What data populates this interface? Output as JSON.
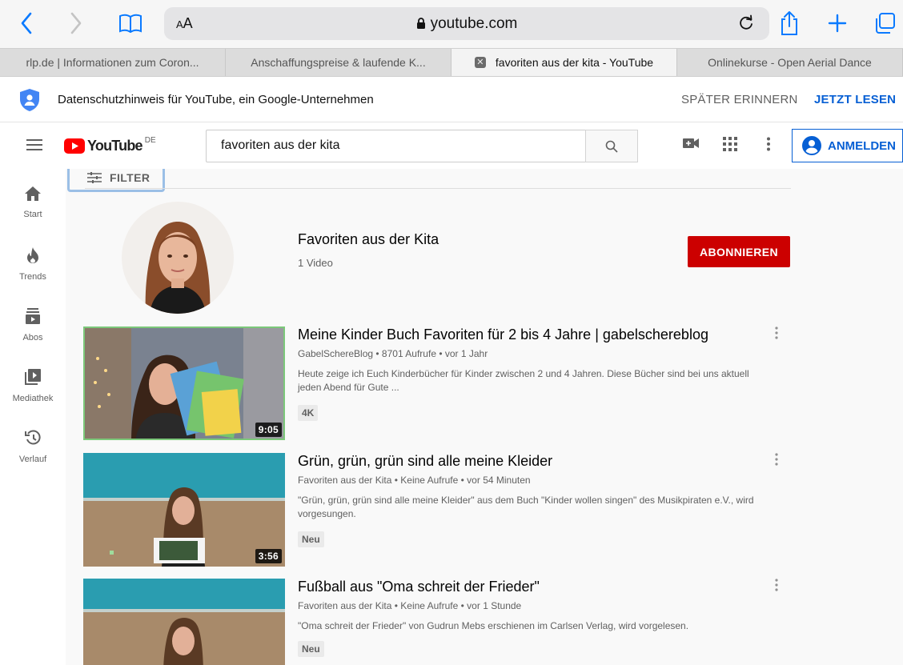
{
  "browser": {
    "text_size_label": "AA",
    "url": "youtube.com",
    "tabs": [
      {
        "label": "rlp.de | Informationen zum Coron..."
      },
      {
        "label": "Anschaffungspreise & laufende K..."
      },
      {
        "label": "favoriten aus der kita - YouTube"
      },
      {
        "label": "Onlinekurse - Open Aerial Dance"
      }
    ]
  },
  "privacy": {
    "text": "Datenschutzhinweis für YouTube, ein Google-Unternehmen",
    "later_label": "SPÄTER ERINNERN",
    "read_label": "JETZT LESEN"
  },
  "masthead": {
    "logo_text": "YouTube",
    "region": "DE",
    "search_value": "favoriten aus der kita",
    "signin_label": "ANMELDEN"
  },
  "sidebar": {
    "items": [
      {
        "label": "Start",
        "icon": "home-icon"
      },
      {
        "label": "Trends",
        "icon": "trending-icon"
      },
      {
        "label": "Abos",
        "icon": "subscriptions-icon"
      },
      {
        "label": "Mediathek",
        "icon": "library-icon"
      },
      {
        "label": "Verlauf",
        "icon": "history-icon"
      }
    ]
  },
  "filter": {
    "label": "FILTER"
  },
  "channel": {
    "name": "Favoriten aus der Kita",
    "meta": "1 Video",
    "subscribe_label": "ABONNIEREN"
  },
  "videos": [
    {
      "title": "Meine Kinder Buch Favoriten für 2 bis 4 Jahre | gabelschereblog",
      "meta": "GabelSchereBlog • 8701 Aufrufe • vor 1 Jahr",
      "description": "Heute zeige ich Euch Kinderbücher für Kinder zwischen 2 und 4 Jahren. Diese Bücher sind bei uns aktuell jeden Abend für Gute ...",
      "badge": "4K",
      "duration": "9:05"
    },
    {
      "title": "Grün, grün, grün sind alle meine Kleider",
      "meta": "Favoriten aus der Kita • Keine Aufrufe • vor 54 Minuten",
      "description": "\"Grün, grün, grün sind alle meine Kleider\" aus dem Buch \"Kinder wollen singen\" des Musikpiraten e.V., wird vorgesungen.",
      "badge": "Neu",
      "duration": "3:56"
    },
    {
      "title": "Fußball aus \"Oma schreit der Frieder\"",
      "meta": "Favoriten aus der Kita • Keine Aufrufe • vor 1 Stunde",
      "description": "\"Oma schreit der Frieder\" von Gudrun Mebs erschienen im Carlsen Verlag, wird vorgelesen.",
      "badge": "Neu",
      "duration": ""
    }
  ],
  "colors": {
    "brand_red": "#cc0000",
    "link_blue": "#065fd4",
    "safari_blue": "#0a7aff"
  }
}
